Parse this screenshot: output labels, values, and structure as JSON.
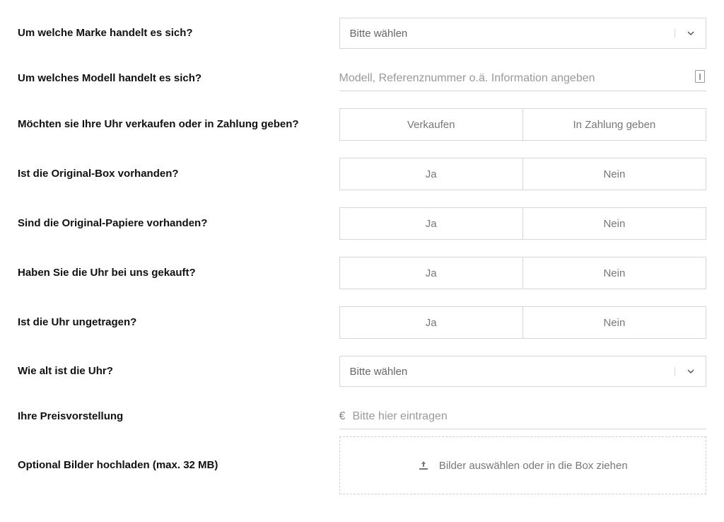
{
  "brand": {
    "label": "Um welche Marke handelt es sich?",
    "placeholder": "Bitte wählen"
  },
  "model": {
    "label": "Um welches Modell handelt es sich?",
    "placeholder": "Modell, Referenznummer o.ä. Information angeben"
  },
  "intent": {
    "label": "Möchten sie Ihre Uhr verkaufen oder in Zahlung geben?",
    "opt1": "Verkaufen",
    "opt2": "In Zahlung geben"
  },
  "box": {
    "label": "Ist die Original-Box vorhanden?",
    "yes": "Ja",
    "no": "Nein"
  },
  "papers": {
    "label": "Sind die Original-Papiere vorhanden?",
    "yes": "Ja",
    "no": "Nein"
  },
  "bought": {
    "label": "Haben Sie die Uhr bei uns gekauft?",
    "yes": "Ja",
    "no": "Nein"
  },
  "unworn": {
    "label": "Ist die Uhr ungetragen?",
    "yes": "Ja",
    "no": "Nein"
  },
  "age": {
    "label": "Wie alt ist die Uhr?",
    "placeholder": "Bitte wählen"
  },
  "price": {
    "label": "Ihre Preisvorstellung",
    "currency": "€",
    "placeholder": "Bitte hier eintragen"
  },
  "upload": {
    "label": "Optional Bilder hochladen (max. 32 MB)",
    "dropzone": "Bilder auswählen oder in die Box ziehen"
  }
}
